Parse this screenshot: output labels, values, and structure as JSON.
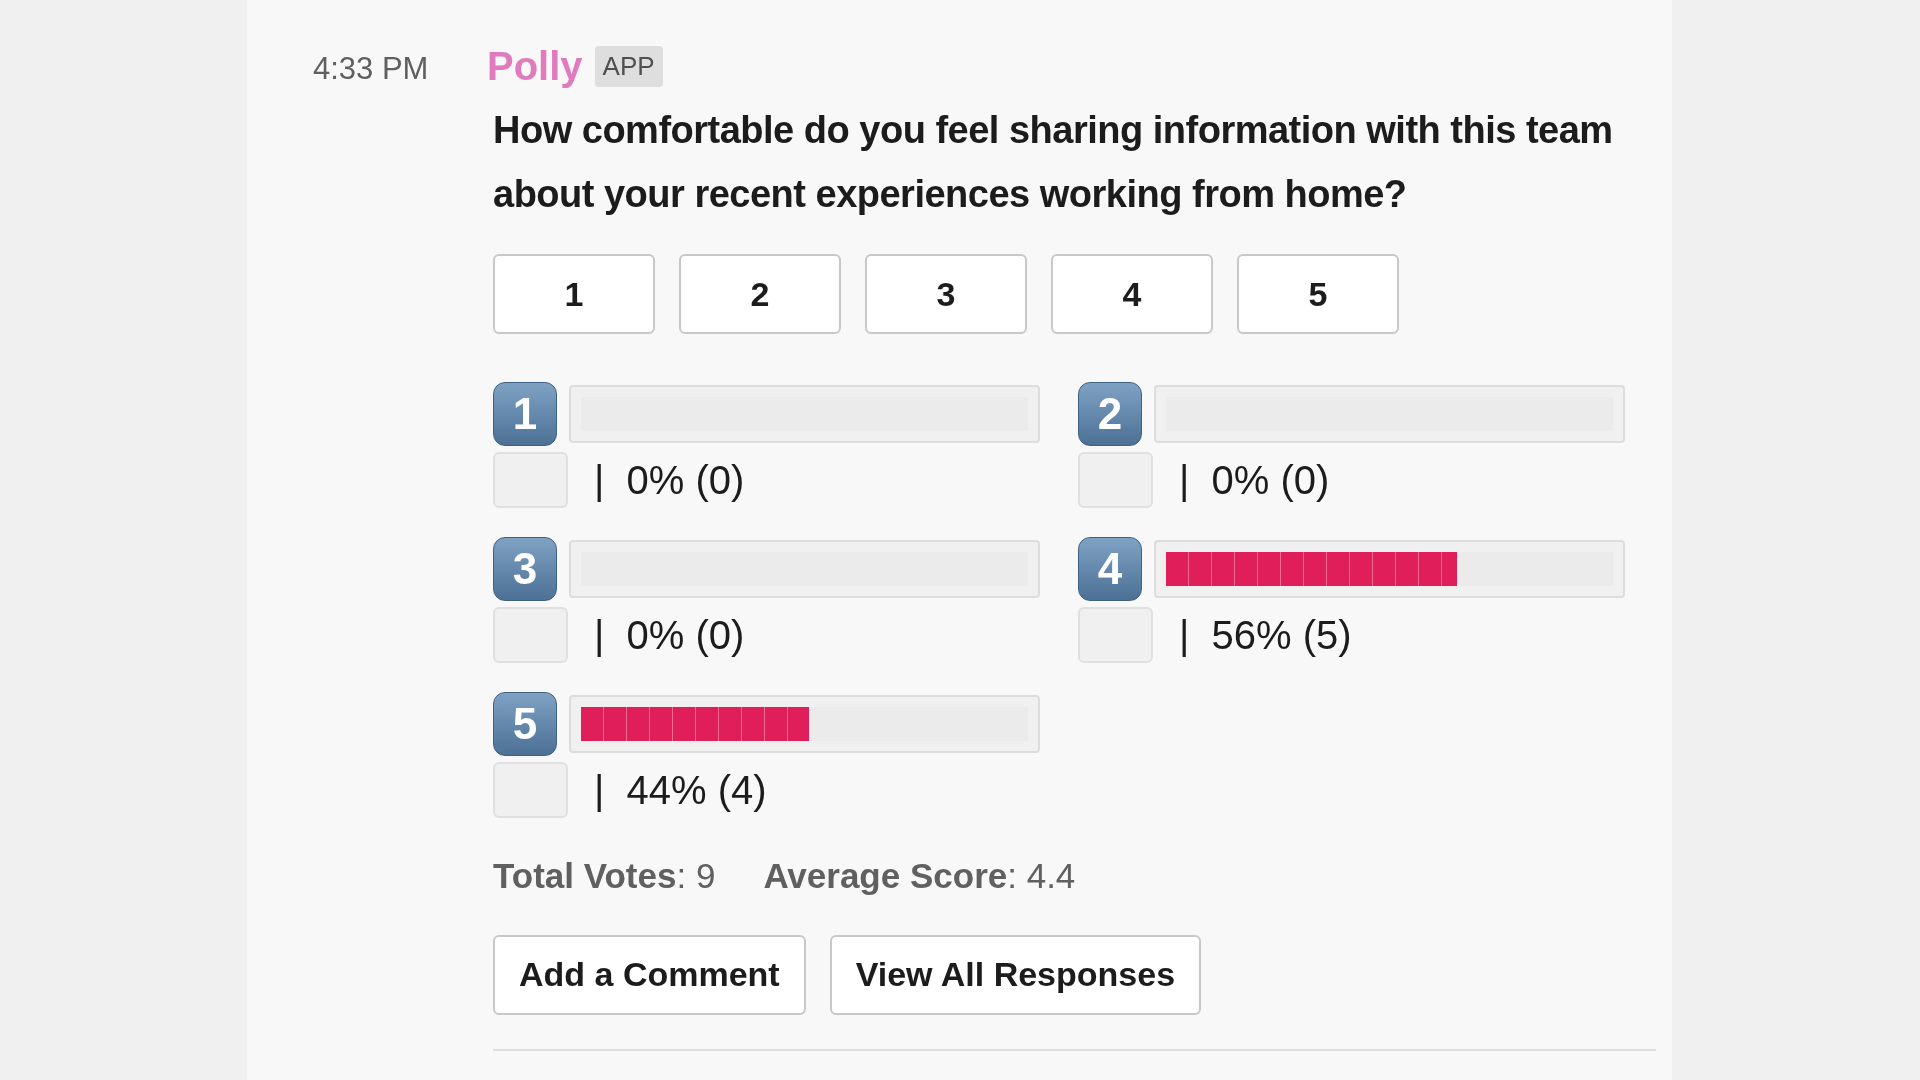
{
  "message": {
    "time": "4:33 PM",
    "sender": "Polly",
    "badge": "APP",
    "question": "How comfortable do you feel sharing information with this team about your recent experiences working from home?",
    "choices": [
      "1",
      "2",
      "3",
      "4",
      "5"
    ],
    "results": [
      {
        "key": "1",
        "level": 0,
        "reading": "|  0% (0)"
      },
      {
        "key": "2",
        "level": 0,
        "reading": "|  0% (0)"
      },
      {
        "key": "3",
        "level": 0,
        "reading": "|  0% (0)"
      },
      {
        "key": "4",
        "level": 0.65,
        "reading": "|  56% (5)"
      },
      {
        "key": "5",
        "level": 0.51,
        "reading": "|  44% (4)"
      }
    ],
    "stats": [
      {
        "label": "Total Votes",
        "value": ": 9"
      },
      {
        "label": "Average Score",
        "value": ": 4.4"
      }
    ],
    "actions": [
      "Add a Comment",
      "View All Responses"
    ]
  }
}
